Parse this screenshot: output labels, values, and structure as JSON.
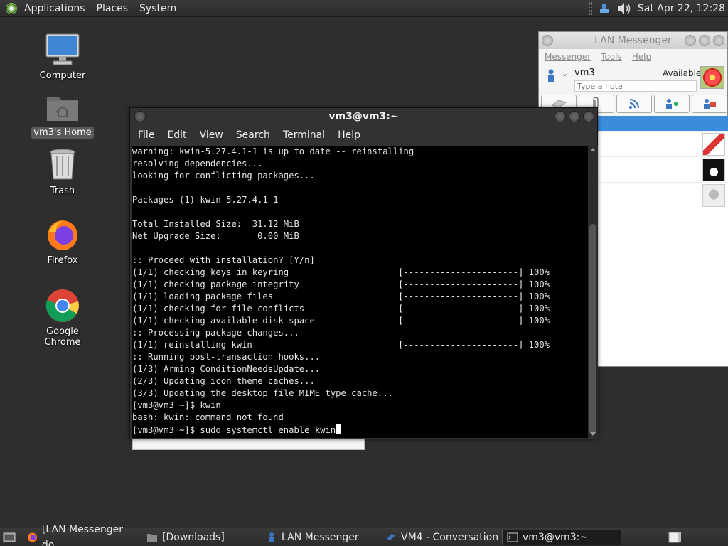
{
  "top_panel": {
    "menus": [
      "Applications",
      "Places",
      "System"
    ],
    "clock": "Sat Apr 22, 12:28"
  },
  "desktop_icons": [
    {
      "label": "Computer",
      "icon": "computer-icon"
    },
    {
      "label": "vm3's Home",
      "icon": "home-folder-icon"
    },
    {
      "label": "Trash",
      "icon": "trash-icon"
    },
    {
      "label": "Firefox",
      "icon": "firefox-icon"
    },
    {
      "label": "Google Chrome",
      "icon": "chrome-icon"
    }
  ],
  "lan_messenger": {
    "title": "LAN Messenger",
    "menus": [
      "Messenger",
      "Tools",
      "Help"
    ],
    "user_name": "vm3",
    "status": "Available",
    "note_placeholder": "Type a note"
  },
  "terminal": {
    "title": "vm3@vm3:~",
    "menus": [
      "File",
      "Edit",
      "View",
      "Search",
      "Terminal",
      "Help"
    ],
    "lines": [
      "warning: kwin-5.27.4.1-1 is up to date -- reinstalling",
      "resolving dependencies...",
      "looking for conflicting packages...",
      "",
      "Packages (1) kwin-5.27.4.1-1",
      "",
      "Total Installed Size:  31.12 MiB",
      "Net Upgrade Size:       0.00 MiB",
      "",
      ":: Proceed with installation? [Y/n]",
      "(1/1) checking keys in keyring                     [----------------------] 100%",
      "(1/1) checking package integrity                   [----------------------] 100%",
      "(1/1) loading package files                        [----------------------] 100%",
      "(1/1) checking for file conflicts                  [----------------------] 100%",
      "(1/1) checking available disk space                [----------------------] 100%",
      ":: Processing package changes...",
      "(1/1) reinstalling kwin                            [----------------------] 100%",
      ":: Running post-transaction hooks...",
      "(1/3) Arming ConditionNeedsUpdate...",
      "(2/3) Updating icon theme caches...",
      "(3/3) Updating the desktop file MIME type cache...",
      "[vm3@vm3 ~]$ kwin",
      "bash: kwin: command not found"
    ],
    "prompt": "[vm3@vm3 ~]$ ",
    "current_command": "sudo systemctl enable kwin"
  },
  "taskbar": [
    {
      "label": "[LAN Messenger do...",
      "icon": "firefox-icon",
      "active": false
    },
    {
      "label": "[Downloads]",
      "icon": "folder-icon",
      "active": false
    },
    {
      "label": "LAN Messenger",
      "icon": "lan-messenger-icon",
      "active": false
    },
    {
      "label": "VM4 - Conversation",
      "icon": "conversation-icon",
      "active": false
    },
    {
      "label": "vm3@vm3:~",
      "icon": "terminal-icon",
      "active": true
    }
  ]
}
